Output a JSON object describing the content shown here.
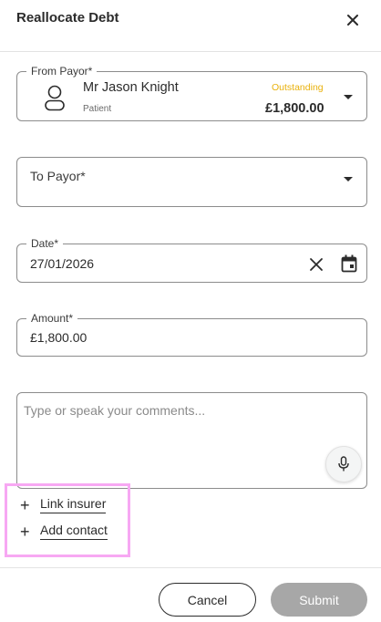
{
  "dialog": {
    "title": "Reallocate Debt"
  },
  "from_payor": {
    "label": "From Payor*",
    "name": "Mr Jason Knight",
    "type": "Patient",
    "status": "Outstanding",
    "amount": "£1,800.00"
  },
  "to_payor": {
    "label": "To Payor*"
  },
  "date": {
    "label": "Date*",
    "value": "27/01/2026"
  },
  "amount": {
    "label": "Amount*",
    "value": "£1,800.00"
  },
  "comments": {
    "placeholder": "Type or speak your comments..."
  },
  "links": {
    "plus_symbol": "+",
    "link_insurer": "Link insurer",
    "add_contact": "Add contact"
  },
  "footer": {
    "cancel": "Cancel",
    "submit": "Submit"
  },
  "colors": {
    "status": "#e9b10c",
    "submit_disabled": "#a7a7a7",
    "highlight": "#f7a8f3"
  },
  "icons": [
    "close-icon",
    "person-icon",
    "dropdown-caret-icon",
    "clear-icon",
    "calendar-icon",
    "microphone-icon",
    "plus-icon"
  ]
}
